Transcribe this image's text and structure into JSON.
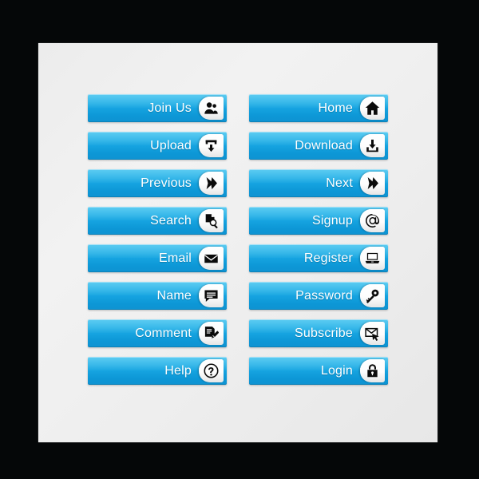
{
  "page": {
    "background_color": "#050708",
    "card_color": "#eeeeee",
    "accent_color": "#15a3e0",
    "icon_plate_color": "#ffffff",
    "icon_color": "#0b0b0b",
    "label_color": "#ffffff"
  },
  "buttons": {
    "left_column": [
      {
        "label": "Join Us",
        "icon": "users-icon"
      },
      {
        "label": "Upload",
        "icon": "upload-arrow-icon"
      },
      {
        "label": "Previous",
        "icon": "arrow-right-icon"
      },
      {
        "label": "Search",
        "icon": "document-magnifier-icon"
      },
      {
        "label": "Email",
        "icon": "envelope-icon"
      },
      {
        "label": "Name",
        "icon": "speech-bubble-icon"
      },
      {
        "label": "Comment",
        "icon": "document-pen-icon"
      },
      {
        "label": "Help",
        "icon": "question-mark-circle-icon"
      }
    ],
    "right_column": [
      {
        "label": "Home",
        "icon": "house-icon"
      },
      {
        "label": "Download",
        "icon": "download-arrow-icon"
      },
      {
        "label": "Next",
        "icon": "arrow-right-icon"
      },
      {
        "label": "Signup",
        "icon": "at-sign-icon"
      },
      {
        "label": "Register",
        "icon": "laptop-icon"
      },
      {
        "label": "Password",
        "icon": "key-icon"
      },
      {
        "label": "Subscribe",
        "icon": "envelope-cursor-icon"
      },
      {
        "label": "Login",
        "icon": "padlock-icon"
      }
    ]
  }
}
